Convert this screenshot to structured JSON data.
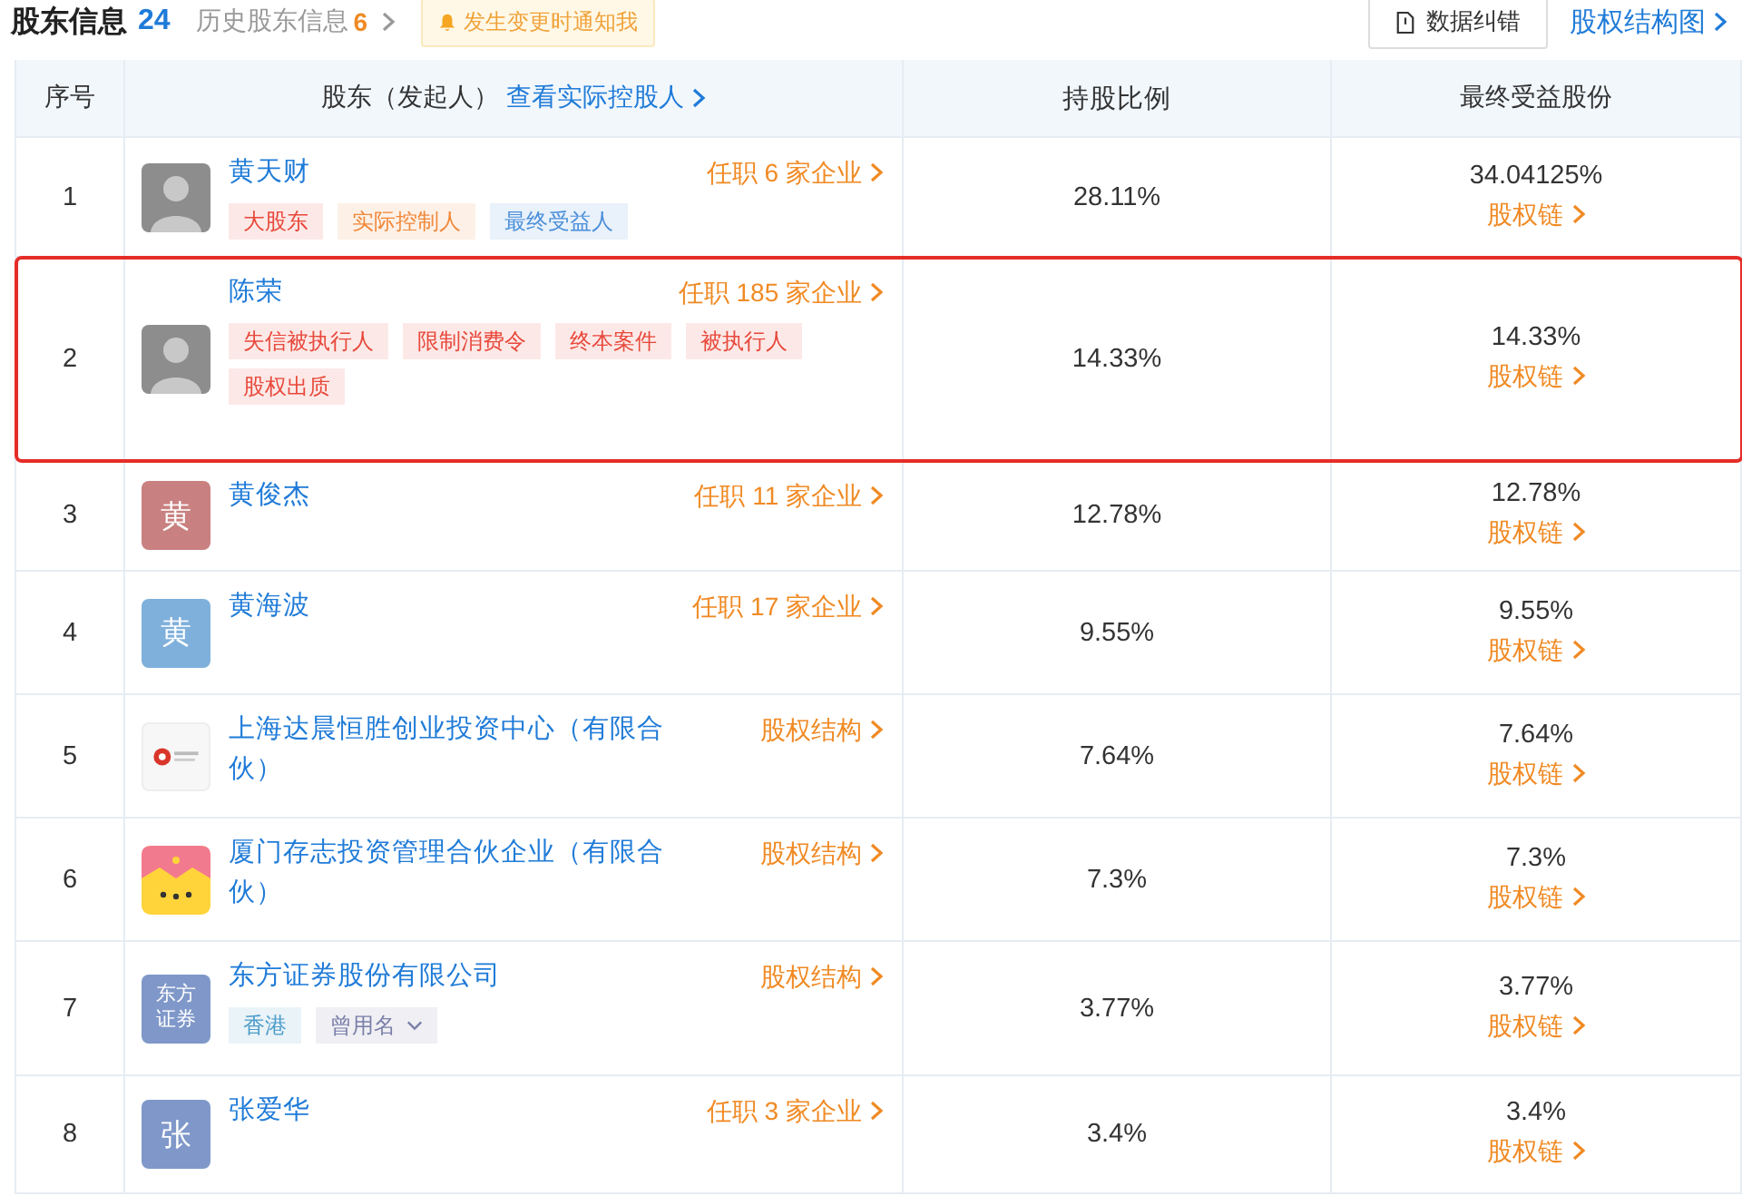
{
  "header": {
    "title": "股东信息",
    "count": "24",
    "history_label": "历史股东信息",
    "history_count": "6",
    "notify_button": "发生变更时通知我",
    "feedback_button": "数据纠错",
    "structure_link": "股权结构图"
  },
  "table": {
    "columns": [
      {
        "label": "序号"
      },
      {
        "label": "股东（发起人）",
        "link": "查看实际控股人"
      },
      {
        "label": "持股比例"
      },
      {
        "label": "最终受益股份"
      }
    ],
    "rows": [
      {
        "index": "1",
        "highlighted": false,
        "avatar": {
          "kind": "photo"
        },
        "name": "黄天财",
        "side_link": "任职 6 家企业",
        "tags": [
          {
            "label": "大股东",
            "color": "#e8483b",
            "kind": "plain"
          },
          {
            "label": "实际控制人",
            "color": "#f0883a",
            "kind": "plain"
          },
          {
            "label": "最终受益人",
            "color": "#4b8fd9",
            "kind": "plain"
          }
        ],
        "ratio": "28.11%",
        "final_share": "34.04125%",
        "final_link": "股权链"
      },
      {
        "index": "2",
        "highlighted": true,
        "avatar": {
          "kind": "photo"
        },
        "name": "陈荣",
        "side_link": "任职 185 家企业",
        "tags": [
          {
            "label": "失信被执行人",
            "color": "#e8483b",
            "kind": "plain"
          },
          {
            "label": "限制消费令",
            "color": "#e8483b",
            "kind": "plain"
          },
          {
            "label": "终本案件",
            "color": "#e8483b",
            "kind": "plain"
          },
          {
            "label": "被执行人",
            "color": "#e8483b",
            "kind": "plain"
          },
          {
            "label": "股权出质",
            "color": "#e8483b",
            "kind": "plain"
          }
        ],
        "ratio": "14.33%",
        "final_share": "14.33%",
        "final_link": "股权链"
      },
      {
        "index": "3",
        "highlighted": false,
        "avatar": {
          "kind": "letter",
          "text": "黄",
          "color": "#c98080"
        },
        "name": "黄俊杰",
        "side_link": "任职 11 家企业",
        "tags": [],
        "ratio": "12.78%",
        "final_share": "12.78%",
        "final_link": "股权链"
      },
      {
        "index": "4",
        "highlighted": false,
        "avatar": {
          "kind": "letter",
          "text": "黄",
          "color": "#7fb0dc"
        },
        "name": "黄海波",
        "side_link": "任职 17 家企业",
        "tags": [],
        "ratio": "9.55%",
        "final_share": "9.55%",
        "final_link": "股权链"
      },
      {
        "index": "5",
        "highlighted": false,
        "avatar": {
          "kind": "logo"
        },
        "name": "上海达晨恒胜创业投资中心（有限合伙）",
        "side_link": "股权结构",
        "tags": [],
        "ratio": "7.64%",
        "final_share": "7.64%",
        "final_link": "股权链"
      },
      {
        "index": "6",
        "highlighted": false,
        "avatar": {
          "kind": "crown"
        },
        "name": "厦门存志投资管理合伙企业（有限合伙）",
        "side_link": "股权结构",
        "tags": [],
        "ratio": "7.3%",
        "final_share": "7.3%",
        "final_link": "股权链"
      },
      {
        "index": "7",
        "highlighted": false,
        "avatar": {
          "kind": "letter",
          "text": "东方证券",
          "color": "#7f98c9"
        },
        "name": "东方证券股份有限公司",
        "side_link": "股权结构",
        "tags": [
          {
            "label": "香港",
            "color": "#4b9bc9",
            "kind": "plain"
          },
          {
            "label": "曾用名",
            "color": "#7a7fa8",
            "kind": "dropdown"
          }
        ],
        "ratio": "3.77%",
        "final_share": "3.77%",
        "final_link": "股权链"
      },
      {
        "index": "8",
        "highlighted": false,
        "avatar": {
          "kind": "letter",
          "text": "张",
          "color": "#7f98c9"
        },
        "name": "张爱华",
        "side_link": "任职 3 家企业",
        "tags": [],
        "ratio": "3.4%",
        "final_share": "3.4%",
        "final_link": "股权链"
      }
    ]
  }
}
